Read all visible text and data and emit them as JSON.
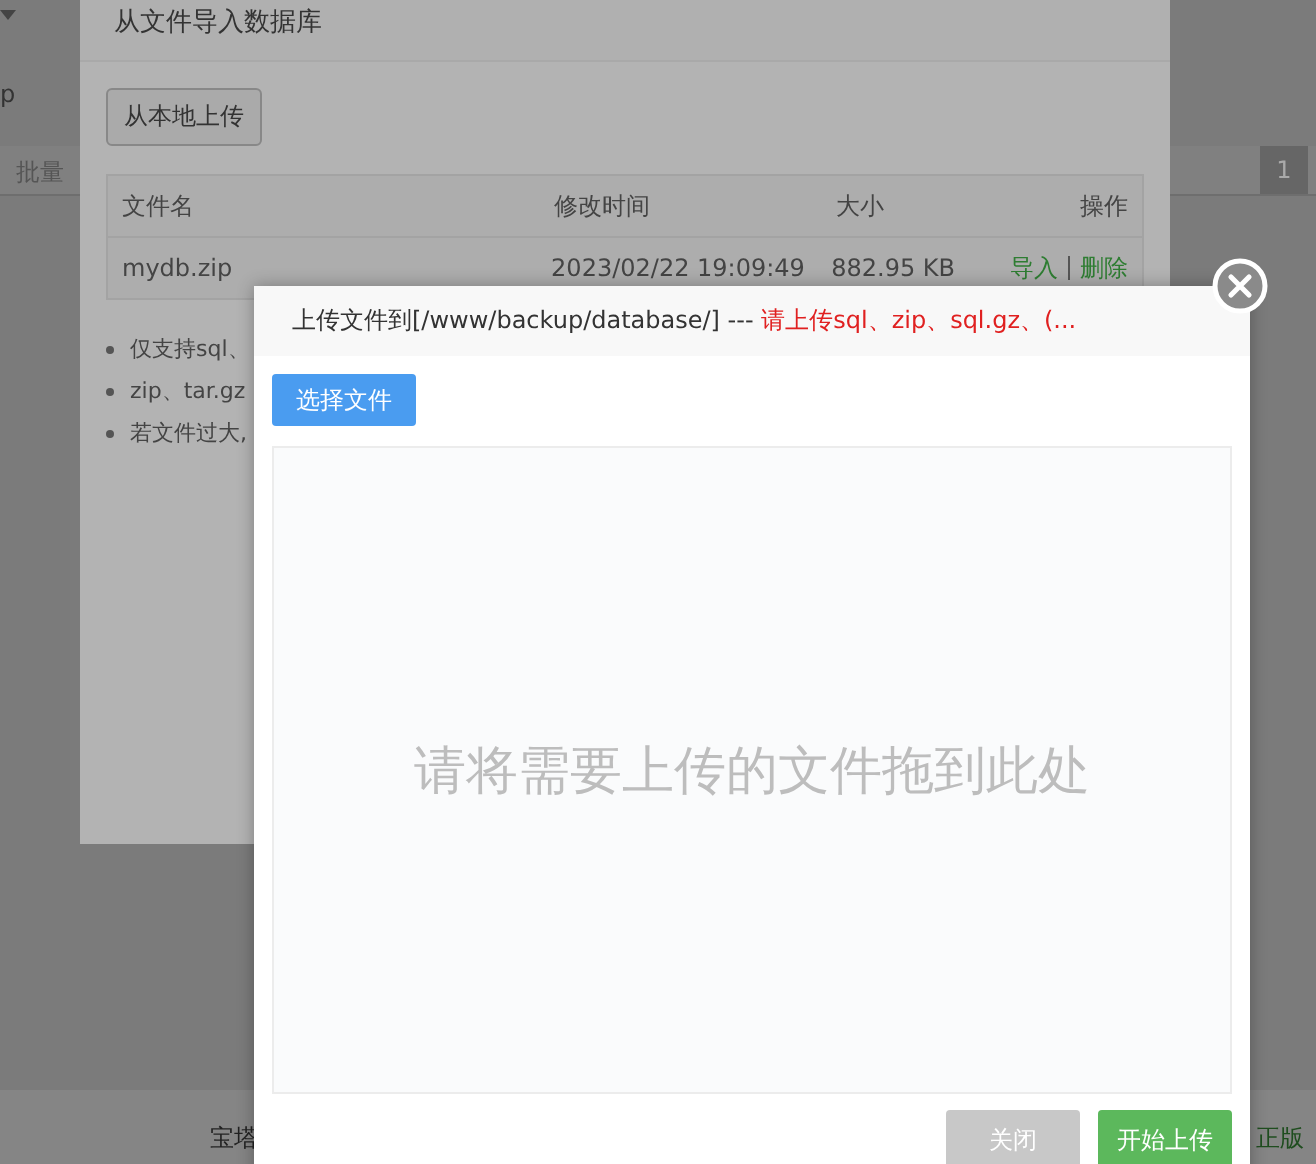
{
  "background_page": {
    "row_text": "p",
    "batch_label": "批量",
    "pager": "1",
    "footer_left": "宝塔",
    "footer_right": "正版"
  },
  "import_dialog": {
    "title": "从文件导入数据库",
    "upload_button": "从本地上传",
    "table": {
      "columns": [
        "文件名",
        "修改时间",
        "大小",
        "操作"
      ],
      "rows": [
        {
          "file_name": "mydb.zip",
          "modified": "2023/02/22 19:09:49",
          "size": "882.95 KB",
          "actions": [
            "导入",
            "删除"
          ]
        }
      ]
    },
    "notes": [
      "仅支持sql、",
      "zip、tar.gz",
      "若文件过大,"
    ]
  },
  "upload_dialog": {
    "title_path": "上传文件到[/www/backup/database/] --- ",
    "title_note": "请上传sql、zip、sql.gz、(...",
    "choose_button": "选择文件",
    "drop_hint": "请将需要上传的文件拖到此处",
    "buttons": [
      {
        "label": "关闭",
        "kind": "secondary"
      },
      {
        "label": "开始上传",
        "kind": "primary"
      }
    ]
  }
}
